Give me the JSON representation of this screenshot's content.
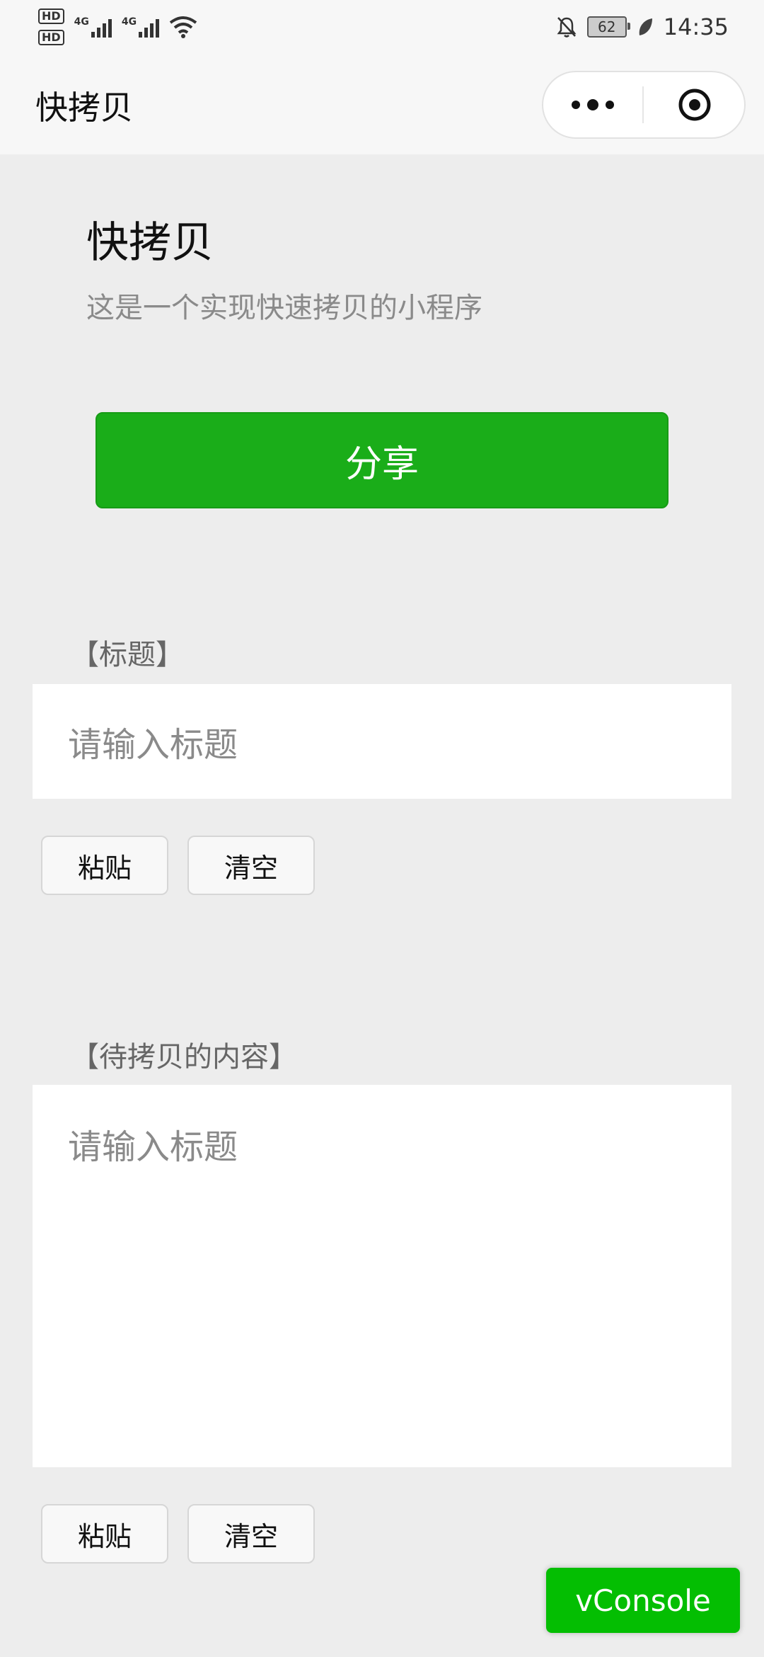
{
  "status_bar": {
    "sim1": "HD",
    "sim2": "HD",
    "net1": "4G",
    "net2": "4G",
    "battery": "62",
    "time": "14:35",
    "icons": [
      "hd-icon",
      "signal-icon",
      "wifi-icon",
      "mute-bell-icon",
      "battery-icon",
      "leaf-icon"
    ]
  },
  "navbar": {
    "title": "快拷贝",
    "more_icon": "more-dots-icon",
    "close_icon": "target-close-icon"
  },
  "header": {
    "title": "快拷贝",
    "description": "这是一个实现快速拷贝的小程序"
  },
  "share_button": {
    "label": "分享",
    "color": "#1aad19"
  },
  "title_section": {
    "label": "【标题】",
    "placeholder": "请输入标题",
    "paste_label": "粘贴",
    "clear_label": "清空"
  },
  "content_section": {
    "label": "【待拷贝的内容】",
    "placeholder": "请输入标题",
    "paste_label": "粘贴",
    "clear_label": "清空"
  },
  "vconsole": {
    "label": "vConsole",
    "color": "#04be02"
  }
}
